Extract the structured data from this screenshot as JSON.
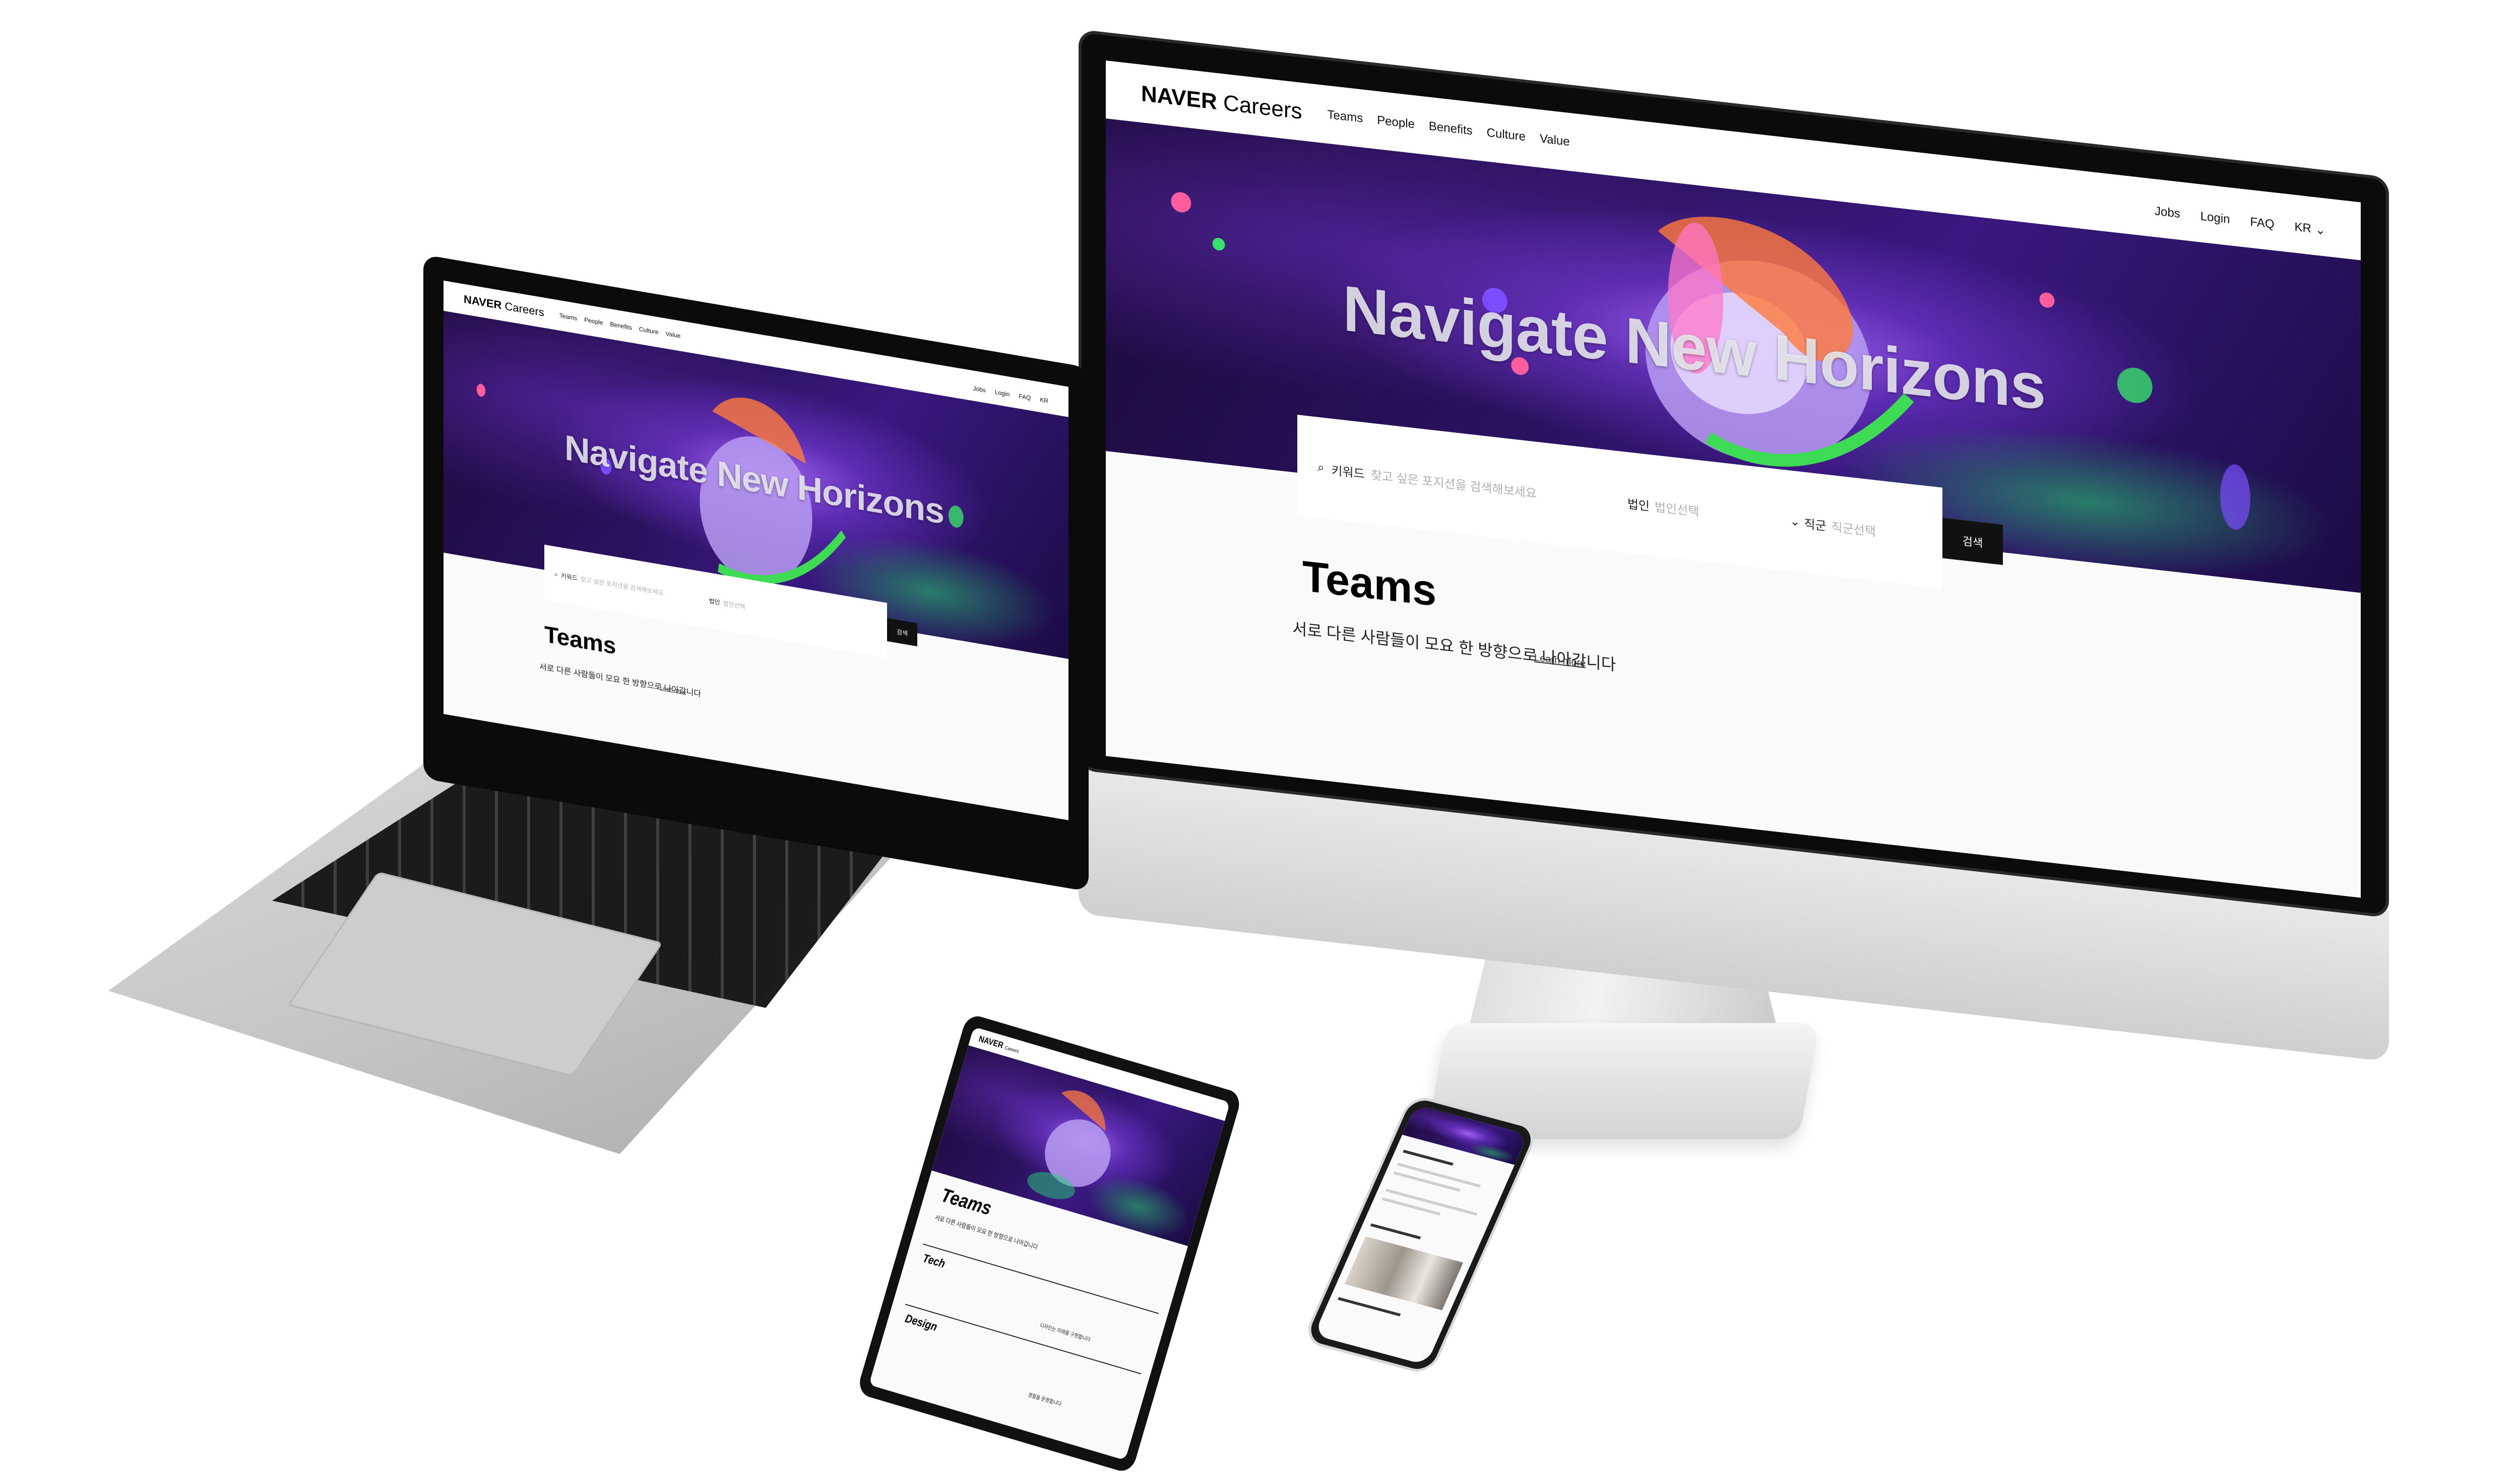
{
  "site": {
    "logo_brand": "NAVER",
    "logo_product": "Careers",
    "nav": [
      "Teams",
      "People",
      "Benefits",
      "Culture",
      "Value"
    ],
    "utility": [
      "Jobs",
      "Login",
      "FAQ",
      "KR"
    ]
  },
  "hero": {
    "title": "Navigate New Horizons"
  },
  "search": {
    "keyword_label": "키워드",
    "keyword_placeholder": "찾고 싶은 포지션을 검색해보세요",
    "company_label": "법인",
    "company_placeholder": "법인선택",
    "job_label": "직군",
    "job_placeholder": "직군선택",
    "button": "검색"
  },
  "teams": {
    "title": "Teams",
    "description": "서로 다른 사람들이 모요 한 방향으로 나아갑니다",
    "learn_more": "Learn more"
  },
  "tablet": {
    "sections": [
      "Tech",
      "Design"
    ],
    "desc_right_1": "디자인는 미래를 구현합니다",
    "desc_right_2": "경험을 운영합니다"
  },
  "colors": {
    "hero_dark": "#2b1260",
    "accent_green": "#3ddc54",
    "button_black": "#111111"
  }
}
